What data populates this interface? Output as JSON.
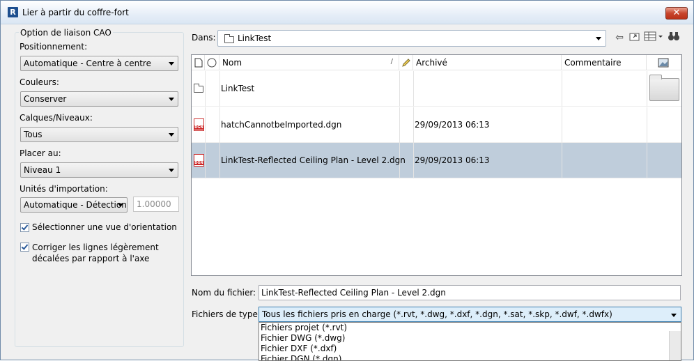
{
  "window": {
    "title": "Lier à partir du coffre-fort",
    "app_icon": "R"
  },
  "options": {
    "group_title": "Option de liaison CAO",
    "positionnement": {
      "label": "Positionnement:",
      "value": "Automatique - Centre à centre"
    },
    "couleurs": {
      "label": "Couleurs:",
      "value": "Conserver"
    },
    "calques": {
      "label": "Calques/Niveaux:",
      "value": "Tous"
    },
    "placer": {
      "label": "Placer au:",
      "value": "Niveau 1"
    },
    "unites": {
      "label": "Unités d'importation:",
      "value": "Automatique - Détection",
      "factor": "1.00000"
    },
    "vue_orientation": {
      "label": "Sélectionner une vue d'orientation",
      "checked": true
    },
    "corriger": {
      "line1": "Corriger les lignes légèrement",
      "line2": "décalées par rapport à l'axe",
      "checked": true
    }
  },
  "browser": {
    "dans_label": "Dans:",
    "location": "LinkTest",
    "columns": {
      "name": "Nom",
      "archived": "Archivé",
      "comment": "Commentaire"
    },
    "files": [
      {
        "name": "LinkTest",
        "archived": "",
        "type": "folder"
      },
      {
        "name": "hatchCannotbeImported.dgn",
        "archived": "29/09/2013 06:13",
        "type": "dgn"
      },
      {
        "name": "LinkTest-Reflected Ceiling Plan - Level 2.dgn",
        "archived": "29/09/2013 06:13",
        "type": "dgn",
        "selected": true
      }
    ],
    "dgn_badge": "DGN"
  },
  "filename": {
    "label": "Nom du fichier:",
    "value": "LinkTest-Reflected Ceiling Plan - Level 2.dgn"
  },
  "filetype": {
    "label": "Fichiers de type:",
    "value": "Tous les fichiers pris en charge (*.rvt, *.dwg, *.dxf, *.dgn, *.sat, *.skp, *.dwf, *.dwfx)",
    "options": [
      "Fichiers projet (*.rvt)",
      "Fichier DWG (*.dwg)",
      "Fichier DXF (*.dxf)",
      "Fichier DGN (*.dgn)"
    ]
  }
}
